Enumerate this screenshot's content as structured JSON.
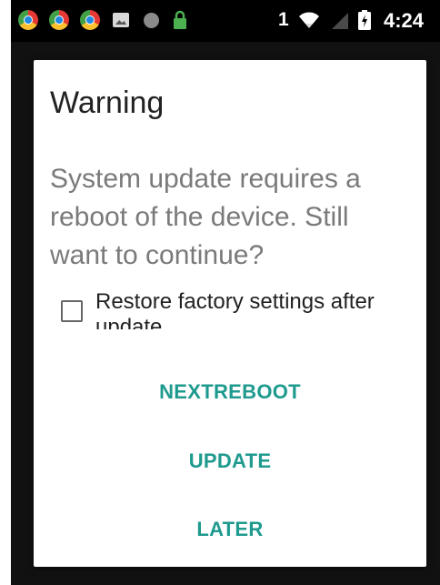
{
  "status_bar": {
    "icons": [
      "chrome-icon",
      "chrome-icon",
      "chrome-icon",
      "image-icon",
      "dot-icon",
      "lock-icon",
      "wifi-icon",
      "no-sim-icon",
      "battery-charging-icon"
    ],
    "sim_number": "1",
    "time": "4:24"
  },
  "dialog": {
    "title": "Warning",
    "message": "System update requires a reboot of the device. Still want to continue?",
    "checkbox": {
      "label": "Restore factory settings after update",
      "checked": false
    },
    "buttons": {
      "next_reboot": "NEXTREBOOT",
      "update": "UPDATE",
      "later": "LATER"
    }
  },
  "colors": {
    "accent": "#1e9a8e",
    "title_text": "#222222",
    "message_text": "#7a7a7a",
    "lock_green": "#4caf50"
  }
}
